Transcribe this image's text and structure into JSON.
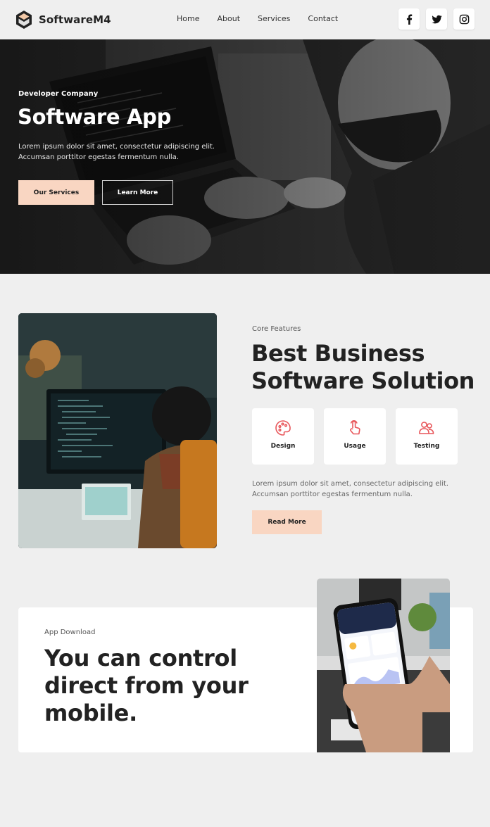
{
  "brand": {
    "name": "SoftwareM4"
  },
  "nav": {
    "items": [
      {
        "label": "Home"
      },
      {
        "label": "About"
      },
      {
        "label": "Services"
      },
      {
        "label": "Contact"
      }
    ],
    "social": [
      "facebook-icon",
      "twitter-icon",
      "instagram-icon"
    ]
  },
  "hero": {
    "eyebrow": "Developer Company",
    "title": "Software App",
    "text": "Lorem ipsum dolor sit amet, consectetur adipiscing elit. Accumsan porttitor egestas fermentum nulla.",
    "primary_button": "Our Services",
    "secondary_button": "Learn More"
  },
  "features": {
    "eyebrow": "Core Features",
    "title": "Best Business Software Solution",
    "cards": [
      {
        "label": "Design",
        "icon": "palette-icon"
      },
      {
        "label": "Usage",
        "icon": "tap-hand-icon"
      },
      {
        "label": "Testing",
        "icon": "users-icon"
      }
    ],
    "text": "Lorem ipsum dolor sit amet, consectetur adipiscing elit. Accumsan porttitor egestas fermentum nulla.",
    "button": "Read More"
  },
  "download": {
    "eyebrow": "App Download",
    "title": "You can control direct from your mobile."
  },
  "colors": {
    "accent": "#f9d6c2",
    "icon_accent": "#e8575b",
    "background": "#efefef",
    "text": "#222222"
  }
}
